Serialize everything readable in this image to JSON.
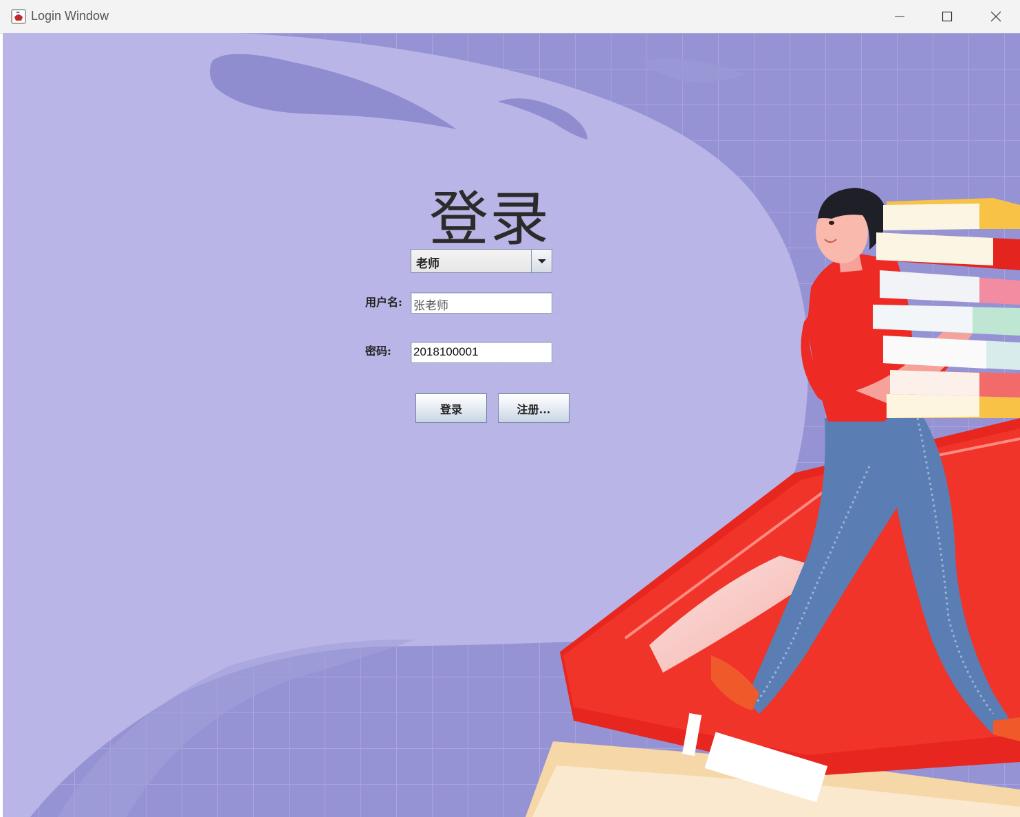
{
  "window": {
    "title": "Login Window"
  },
  "login": {
    "heading": "登录",
    "role_selected": "老师",
    "username_label": "用户名:",
    "username_value": "张老师",
    "password_label": "密码:",
    "password_value": "2018100001",
    "login_button": "登录",
    "register_button": "注册..."
  },
  "icons": {
    "app": "java-cup-icon",
    "minimize": "minimize-icon",
    "maximize": "maximize-icon",
    "close": "close-icon",
    "dropdown": "chevron-down-icon"
  },
  "colors": {
    "background": "#9a97d6",
    "cloud": "#bab7e6",
    "shirt": "#ee2a24",
    "jeans": "#557bb0",
    "book_red": "#e3241f",
    "book_yellow": "#f7c245",
    "text": "#2b2b2b"
  }
}
